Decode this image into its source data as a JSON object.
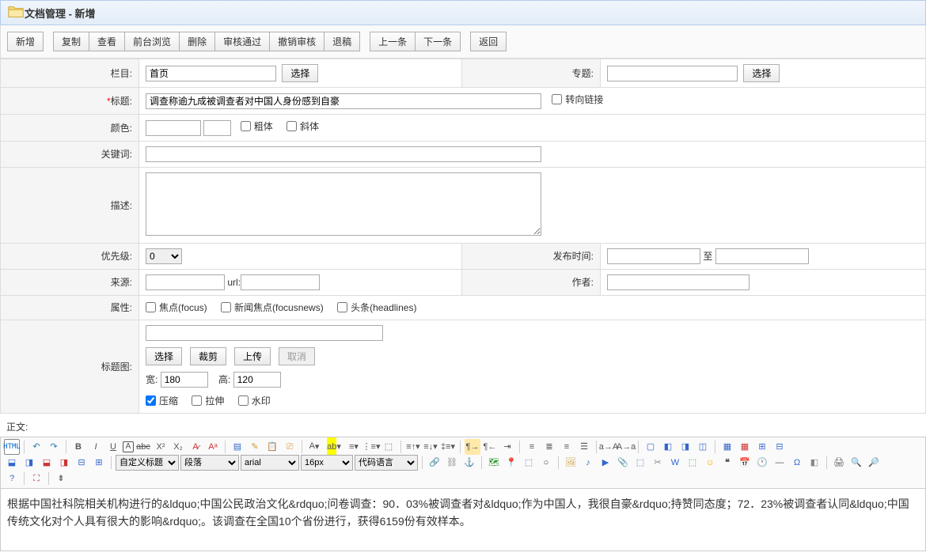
{
  "header": {
    "title": "文档管理 - 新增"
  },
  "toolbar": {
    "new": "新增",
    "copy": "复制",
    "view": "查看",
    "preview": "前台浏览",
    "delete": "删除",
    "approve": "审核通过",
    "revoke": "撤销审核",
    "reject": "退稿",
    "prev": "上一条",
    "next": "下一条",
    "back": "返回"
  },
  "form": {
    "column": {
      "label": "栏目:",
      "value": "首页",
      "select": "选择"
    },
    "topic": {
      "label": "专题:",
      "value": "",
      "select": "选择"
    },
    "title": {
      "label": "标题:",
      "value": "调查称逾九成被调查者对中国人身份感到自豪",
      "redirect": "转向链接"
    },
    "color": {
      "label": "颜色:",
      "bold": "粗体",
      "italic": "斜体"
    },
    "keyword": {
      "label": "关键词:",
      "value": ""
    },
    "desc": {
      "label": "描述:",
      "value": ""
    },
    "priority": {
      "label": "优先级:",
      "value": "0"
    },
    "pubtime": {
      "label": "发布时间:",
      "from": "",
      "to_label": "至",
      "to": ""
    },
    "source": {
      "label": "来源:",
      "url_label": "url:",
      "value": "",
      "url": ""
    },
    "author": {
      "label": "作者:",
      "value": ""
    },
    "attrs": {
      "label": "属性:",
      "focus": "焦点(focus)",
      "focusnews": "新闻焦点(focusnews)",
      "headlines": "头条(headlines)"
    },
    "titleimg": {
      "label": "标题图:",
      "select": "选择",
      "crop": "裁剪",
      "upload": "上传",
      "cancel": "取消",
      "width_label": "宽:",
      "width": "180",
      "height_label": "高:",
      "height": "120",
      "compress": "压缩",
      "stretch": "拉伸",
      "watermark": "水印"
    }
  },
  "content": {
    "label": "正文:"
  },
  "editor": {
    "custom_heading": "自定义标题",
    "paragraph": "段落",
    "font": "arial",
    "size": "16px",
    "code": "代码语言",
    "body": "根据中国社科院相关机构进行的&ldquo;中国公民政治文化&rdquo;问卷调查：90．03%被调查者对&ldquo;作为中国人，我很自豪&rdquo;持赞同态度；72．23%被调查者认同&ldquo;中国传统文化对个人具有很大的影响&rdquo;。该调查在全国10个省份进行，获得6159份有效样本。"
  }
}
